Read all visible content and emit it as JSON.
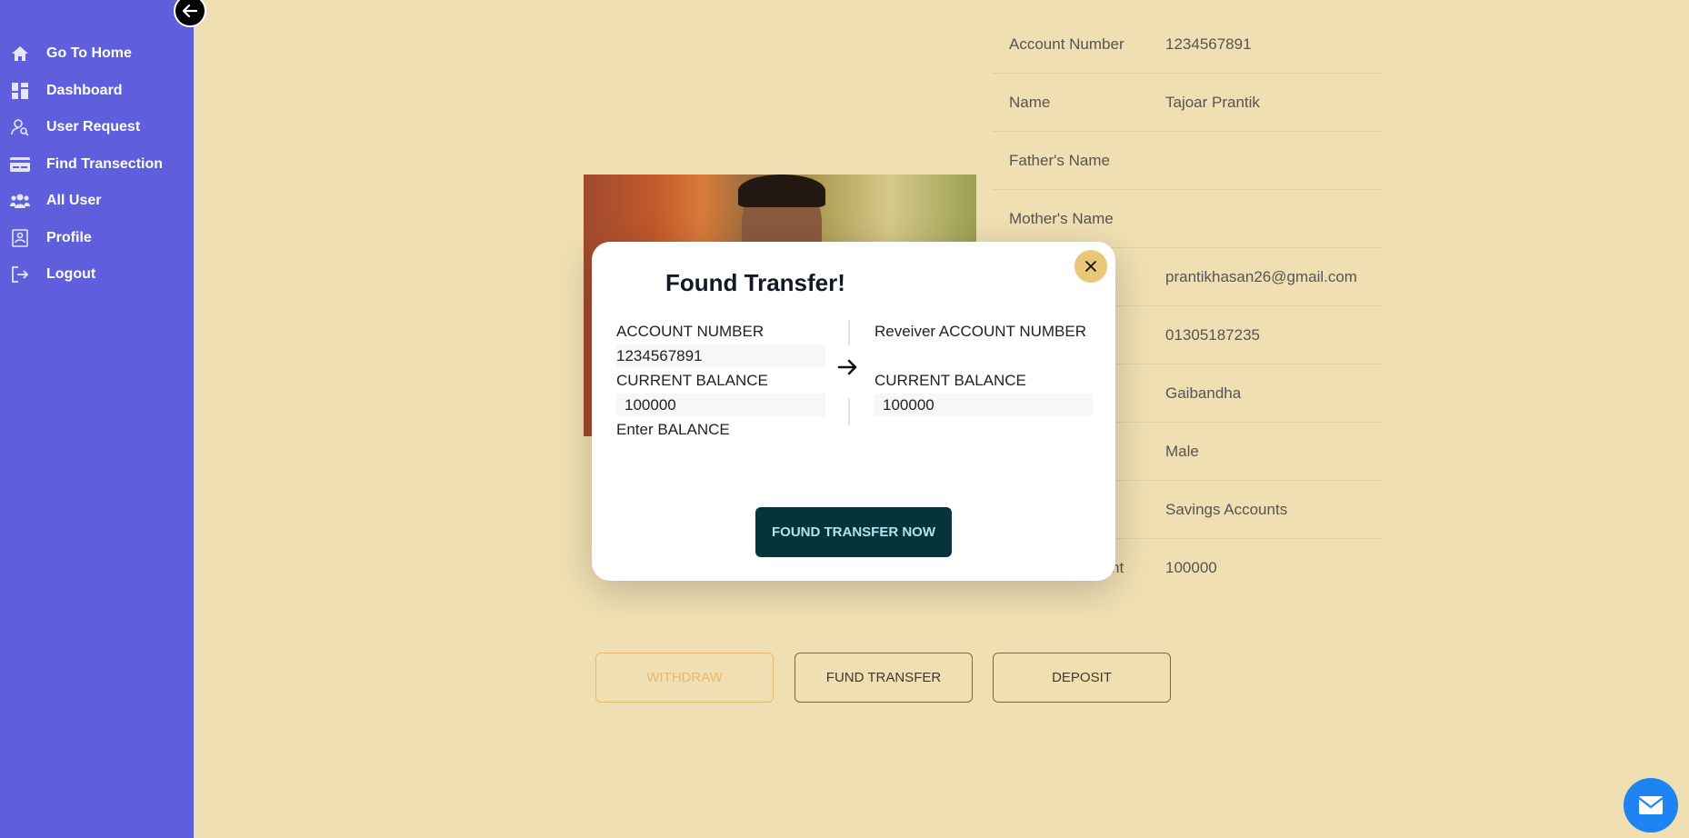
{
  "sidebar": {
    "items": [
      {
        "label": "Go To Home",
        "icon": "home-icon"
      },
      {
        "label": "Dashboard",
        "icon": "dashboard-icon"
      },
      {
        "label": "User Request",
        "icon": "user-search-icon"
      },
      {
        "label": "Find Transection",
        "icon": "card-icon"
      },
      {
        "label": "All User",
        "icon": "users-icon"
      },
      {
        "label": "Profile",
        "icon": "profile-icon"
      },
      {
        "label": "Logout",
        "icon": "logout-icon"
      }
    ]
  },
  "profile": {
    "rows": [
      {
        "key": "Account Number",
        "value": "1234567891"
      },
      {
        "key": "Name",
        "value": "Tajoar Prantik"
      },
      {
        "key": "Father's Name",
        "value": ""
      },
      {
        "key": "Mother's Name",
        "value": ""
      },
      {
        "key": "",
        "value": "prantikhasan26@gmail.com"
      },
      {
        "key": "",
        "value": "01305187235"
      },
      {
        "key": "",
        "value": "Gaibandha"
      },
      {
        "key": "",
        "value": "Male"
      },
      {
        "key": "",
        "value": "Savings Accounts"
      },
      {
        "key": "nt",
        "value": "100000"
      }
    ]
  },
  "actions": {
    "withdraw": "WITHDRAW",
    "fund_transfer": "FUND TRANSFER",
    "deposit": "DEPOSIT"
  },
  "modal": {
    "title": "Found Transfer!",
    "left": {
      "account_label": "ACCOUNT NUMBER",
      "account_value": "1234567891",
      "balance_label": "CURRENT BALANCE",
      "balance_value": "100000",
      "enter_label": "Enter BALANCE"
    },
    "right": {
      "account_label": "Reveiver ACCOUNT NUMBER",
      "balance_label": "CURRENT BALANCE",
      "balance_value": "100000"
    },
    "submit_label": "FOUND TRANSFER NOW"
  },
  "colors": {
    "sidebar": "#5f5fdd",
    "background": "#efdfb3",
    "primary_button": "#07343a",
    "close_button": "#e9c779",
    "mail_button": "#1d84f2"
  }
}
